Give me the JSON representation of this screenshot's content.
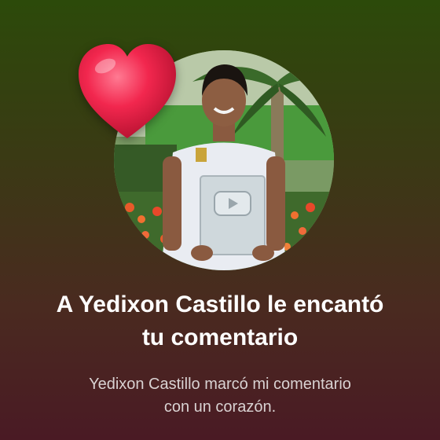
{
  "notification": {
    "headline_line1": "A Yedixon Castillo le encantó",
    "headline_line2": "tu comentario",
    "subtext_line1": "Yedixon Castillo marcó mi comentario",
    "subtext_line2": "con un corazón."
  },
  "icons": {
    "reaction": "heart-icon"
  },
  "colors": {
    "heart": "#e8204a",
    "text": "#ffffff",
    "subtext": "#d9d2d2",
    "background_top": "#2c4a0a",
    "background_bottom": "#4a1a24"
  }
}
